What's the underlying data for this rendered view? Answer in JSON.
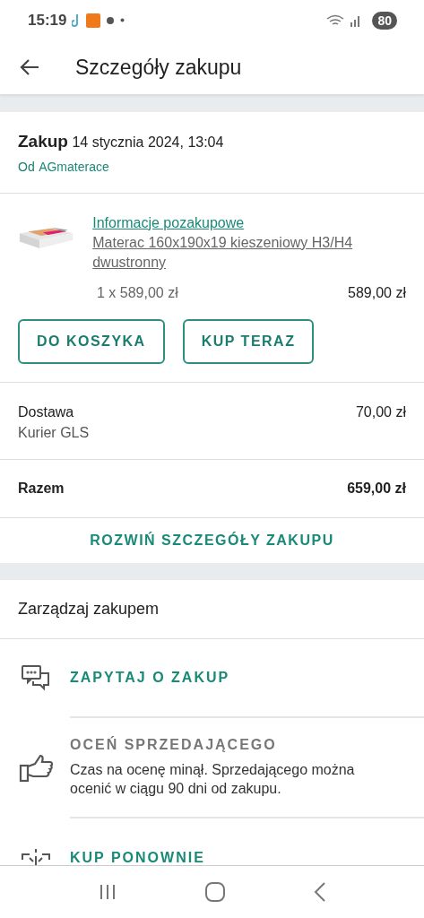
{
  "status_bar": {
    "time": "15:19",
    "battery": "80"
  },
  "header": {
    "title": "Szczegóły zakupu"
  },
  "purchase": {
    "label": "Zakup",
    "date": "14 stycznia 2024, 13:04",
    "seller_prefix": "Od",
    "seller": "AGmaterace"
  },
  "item": {
    "info_link": "Informacje pozakupowe",
    "name": "Materac 160x190x19 kieszeniowy H3/H4 dwustronny",
    "quantity_price": "1 x 589,00 zł",
    "total": "589,00 zł"
  },
  "item_buttons": [
    "DO KOSZYKA",
    "KUP TERAZ"
  ],
  "delivery": {
    "label": "Dostawa",
    "price": "70,00 zł",
    "carrier": "Kurier GLS"
  },
  "sum": {
    "label": "Razem",
    "price": "659,00 zł"
  },
  "expand_link": "ROZWIŃ SZCZEGÓŁY ZAKUPU",
  "manage": {
    "title": "Zarządzaj zakupem",
    "actions": [
      {
        "kind": "chat",
        "label": "ZAPYTAJ O ZAKUP",
        "disabled": false
      },
      {
        "kind": "rate",
        "label": "OCEŃ SPRZEDAJĄCEGO",
        "disabled": true,
        "note": "Czas na ocenę minął. Sprzedającego można ocenić w ciągu 90 dni od zakupu."
      },
      {
        "kind": "rebuy",
        "label": "KUP PONOWNIE",
        "disabled": false
      }
    ]
  }
}
